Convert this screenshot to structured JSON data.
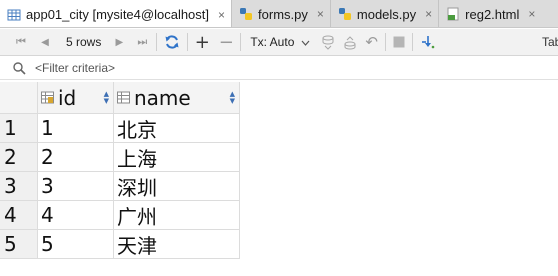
{
  "tabs": [
    {
      "label": "app01_city [mysite4@localhost]",
      "close": "×",
      "active": true,
      "icon": "table-icon"
    },
    {
      "label": "forms.py",
      "close": "×",
      "active": false,
      "icon": "python-file-icon"
    },
    {
      "label": "models.py",
      "close": "×",
      "active": false,
      "icon": "python-file-icon"
    },
    {
      "label": "reg2.html",
      "close": "×",
      "active": false,
      "icon": "html-file-icon"
    }
  ],
  "toolbar": {
    "rows_label": "5 rows",
    "tx_label": "Tx: Auto",
    "tab_label": "Tab",
    "buttons": {
      "first_page": "⏮",
      "prev_page": "◀",
      "next_page": "▶",
      "last_page": "⏭",
      "add_row": "+",
      "delete_row": "−",
      "revert": "↶"
    }
  },
  "filter": {
    "placeholder": "<Filter criteria>"
  },
  "table": {
    "columns": [
      {
        "name": "id"
      },
      {
        "name": "name"
      }
    ],
    "rows": [
      {
        "num": "1",
        "id": "1",
        "name": "北京"
      },
      {
        "num": "2",
        "id": "2",
        "name": "上海"
      },
      {
        "num": "3",
        "id": "3",
        "name": "深圳"
      },
      {
        "num": "4",
        "id": "4",
        "name": "广州"
      },
      {
        "num": "5",
        "id": "5",
        "name": "天津"
      }
    ]
  },
  "colors": {
    "tab_bar": "#dcdcdc",
    "toolbar": "#f2f2f2",
    "accent_blue": "#3d6fb4",
    "sync_blue": "#2f73c9"
  }
}
